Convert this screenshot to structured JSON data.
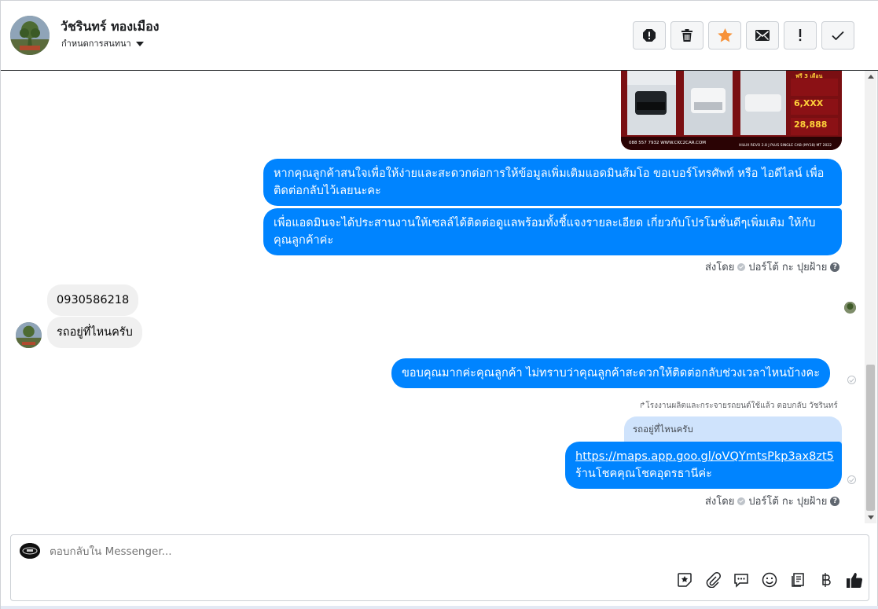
{
  "header": {
    "contact_name": "วัชรินทร์ ทองเมือง",
    "settings_label": "กำหนดการสนทนา",
    "actions": [
      "report-icon",
      "trash-icon",
      "star-icon",
      "envelope-icon",
      "exclamation-icon",
      "checkmark-icon"
    ],
    "star_color": "#f7923a"
  },
  "car_ad": {
    "lines": [
      "ฟรี 3 เดือน",
      "6,XXX",
      "28,888",
      "088 557 7932 WWW.CKC2CAR.COM",
      "HILUX REVO 2.8 J PLUS SINGLE CAB (MY18) MT 2022"
    ]
  },
  "messages": {
    "out_1": "หากคุณลูกค้าสนใจเพื่อให้ง่ายและสะดวกต่อการให้ข้อมูลเพิ่มเติมแอดมินส้มโอ ขอเบอร์โทรศัพท์ หรือ ไอดีไลน์ เพื่อติดต่อกลับไว้เลยนะคะ",
    "out_2": "เพื่อแอดมินจะได้ประสานงานให้เซลล์ได้ติดต่อดูแลพร้อมทั้งชี้แจงรายละเอียด เกี่ยวกับโปรโมชั่นดีๆเพิ่มเติม ให้กับคุณลูกค้าค่ะ",
    "sent_by_label": "ส่งโดย",
    "sender_name": "ปอร์โต้ กะ ปุยฝ้าย",
    "in_1": "0930586218",
    "in_2": "รถอยู่ที่ไหนครับ",
    "out_3": "ขอบคุณมากค่ะคุณลูกค้า ไม่ทราบว่าคุณลูกค้าสะดวกให้ติดต่อกลับช่วงเวลาไหนบ้างคะ",
    "reply_meta": "โรงงานผลิตและกระจายรถยนต์ใช้แล้ว ตอบกลับ วัชรินทร์",
    "quoted": "รถอยู่ที่ไหนครับ",
    "out_4_link": "https://maps.app.goo.gl/oVQYmtsPkp3ax8zt5",
    "out_4_text": "ร้านโชคคุณโชคอุดรธานีค่ะ"
  },
  "composer": {
    "placeholder": "ตอบกลับใน Messenger...",
    "tools": [
      "sticker-icon",
      "attach-icon",
      "saved-reply-icon",
      "emoji-icon",
      "catalog-icon",
      "baht-icon",
      "thumbs-up-icon"
    ]
  },
  "colors": {
    "outgoing_bubble": "#0084ff",
    "incoming_bubble": "#f0f0f0",
    "quoted_bubble": "#cfe3fc"
  }
}
